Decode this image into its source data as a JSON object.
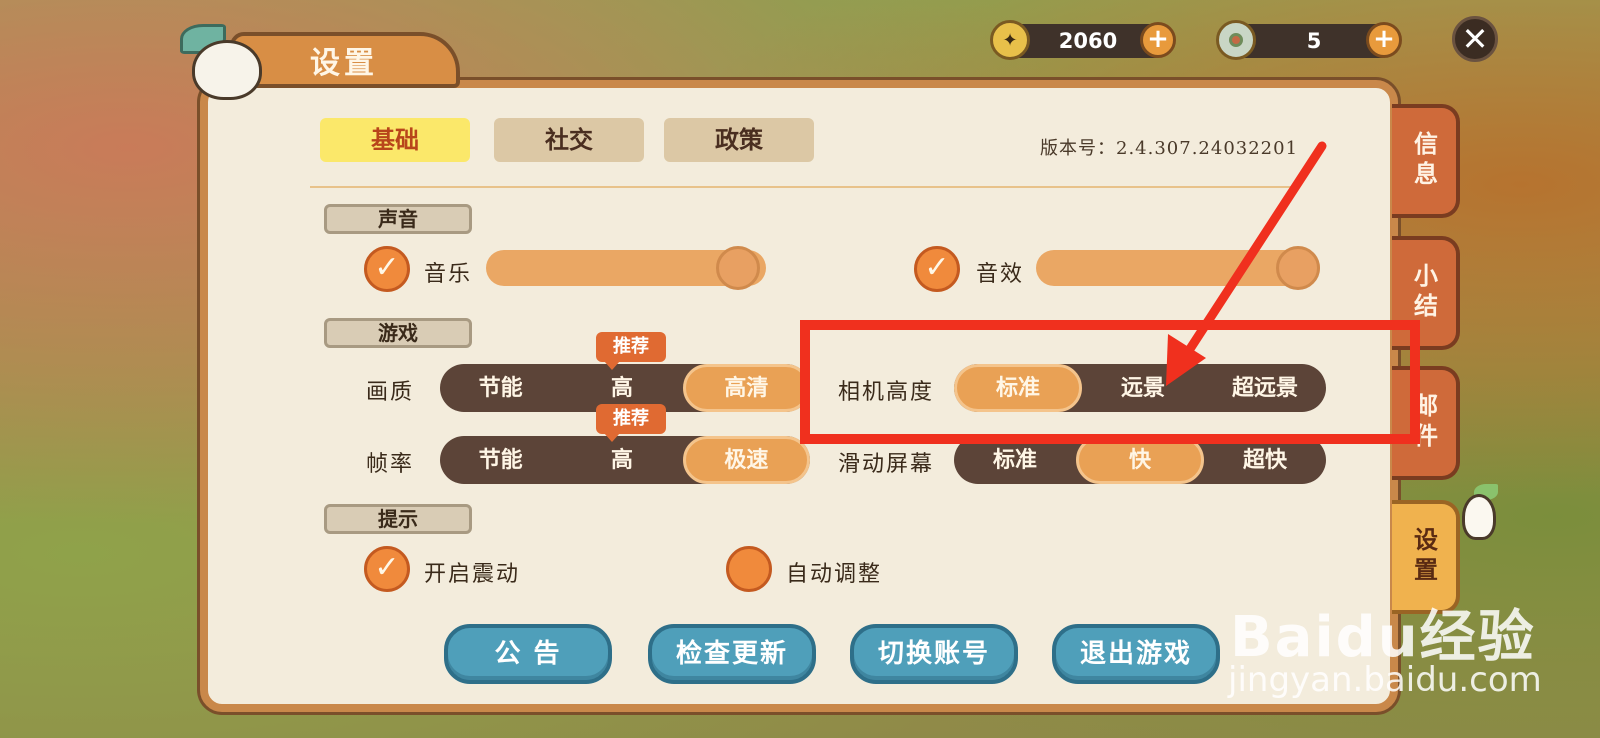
{
  "header": {
    "title": "设置",
    "currency_gold": "2060",
    "currency_ring": "5",
    "plus_symbol": "+",
    "close_symbol": "✕"
  },
  "tabs": [
    {
      "label": "基础",
      "active": true
    },
    {
      "label": "社交",
      "active": false
    },
    {
      "label": "政策",
      "active": false
    }
  ],
  "version": "版本号：2.4.307.24032201",
  "sections": {
    "sound": "声音",
    "game": "游戏",
    "hint": "提示"
  },
  "sound": {
    "music_label": "音乐",
    "music_checked": true,
    "music_level": 1.0,
    "sfx_label": "音效",
    "sfx_checked": true,
    "sfx_level": 1.0,
    "check_mark": "✓"
  },
  "game": {
    "quality_label": "画质",
    "quality_options": [
      "节能",
      "高",
      "高清"
    ],
    "quality_selected": "高清",
    "framerate_label": "帧率",
    "framerate_options": [
      "节能",
      "高",
      "极速"
    ],
    "framerate_selected": "极速",
    "recommend_badge": "推荐",
    "camera_label": "相机高度",
    "camera_options": [
      "标准",
      "远景",
      "超远景"
    ],
    "camera_selected": "标准",
    "scroll_label": "滑动屏幕",
    "scroll_options": [
      "标准",
      "快",
      "超快"
    ],
    "scroll_selected": "快"
  },
  "hint": {
    "vibrate_label": "开启震动",
    "vibrate_checked": true,
    "auto_adjust_label": "自动调整",
    "auto_adjust_checked": false
  },
  "buttons": {
    "notice": "公 告",
    "check_update": "检查更新",
    "switch_account": "切换账号",
    "quit_game": "退出游戏"
  },
  "side_tabs": [
    {
      "label": "信息",
      "active": false
    },
    {
      "label": "小结",
      "active": false
    },
    {
      "label": "邮件",
      "active": false
    },
    {
      "label": "设置",
      "active": true
    }
  ],
  "watermark": {
    "logo": "Baidu经验",
    "url": "jingyan.baidu.com"
  },
  "colors": {
    "annotation": "#f0301e",
    "accent_orange": "#e9a155",
    "button_blue": "#4f9fba",
    "active_tab": "#fbe86a"
  }
}
